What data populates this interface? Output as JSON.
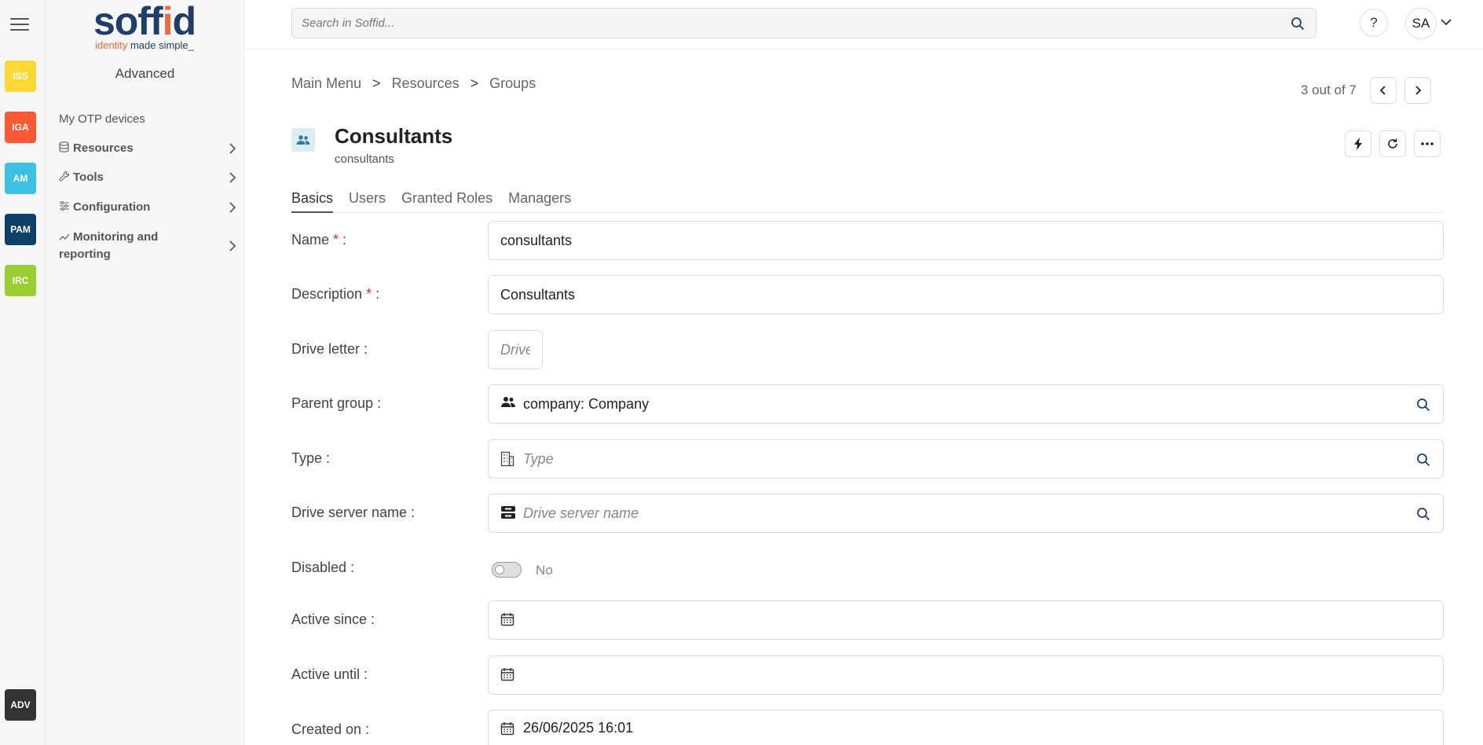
{
  "rail": {
    "apps": [
      {
        "label": "ISS",
        "color": "#fdd835"
      },
      {
        "label": "IGA",
        "color": "#ff5a36"
      },
      {
        "label": "AM",
        "color": "#3cc0e4"
      },
      {
        "label": "PAM",
        "color": "#0d4066"
      },
      {
        "label": "IRC",
        "color": "#9acd32"
      }
    ],
    "bottom_app": {
      "label": "ADV",
      "color": "#333333"
    }
  },
  "logo": {
    "word_a": "soff",
    "word_b": "i",
    "word_c": "d",
    "tag_a": "identity ",
    "tag_b": "made simple_"
  },
  "sidemenu": {
    "title": "Advanced",
    "items": [
      {
        "label": "My OTP devices"
      },
      {
        "label": "Resources",
        "icon": "database-icon"
      },
      {
        "label": "Tools",
        "icon": "wrench-icon"
      },
      {
        "label": "Configuration",
        "icon": "sliders-icon"
      },
      {
        "label": "Monitoring and reporting",
        "icon": "chart-line-icon"
      }
    ]
  },
  "header": {
    "search_placeholder": "Search in Soffid...",
    "help_label": "?",
    "user_initials": "SA"
  },
  "breadcrumb": {
    "items": [
      "Main Menu",
      "Resources",
      "Groups"
    ],
    "separator": ">"
  },
  "pager": {
    "text": "3 out of 7"
  },
  "object": {
    "title": "Consultants",
    "subtitle": "consultants"
  },
  "tabs": [
    "Basics",
    "Users",
    "Granted Roles",
    "Managers"
  ],
  "form": {
    "name": {
      "label": "Name",
      "required": "*",
      "colon": " :",
      "value": "consultants"
    },
    "description": {
      "label": "Description",
      "required": "*",
      "colon": " :",
      "value": "Consultants"
    },
    "drive_letter": {
      "label": "Drive letter :",
      "placeholder": "Drive letter"
    },
    "parent_group": {
      "label": "Parent group :",
      "value": "company: Company"
    },
    "type": {
      "label": "Type :",
      "placeholder": "Type"
    },
    "drive_server": {
      "label": "Drive server name :",
      "placeholder": "Drive server name"
    },
    "disabled": {
      "label": "Disabled :",
      "value": "No"
    },
    "active_since": {
      "label": "Active since :",
      "value": ""
    },
    "active_until": {
      "label": "Active until :",
      "value": ""
    },
    "created_on": {
      "label": "Created on :",
      "value": "26/06/2025 16:01"
    }
  }
}
